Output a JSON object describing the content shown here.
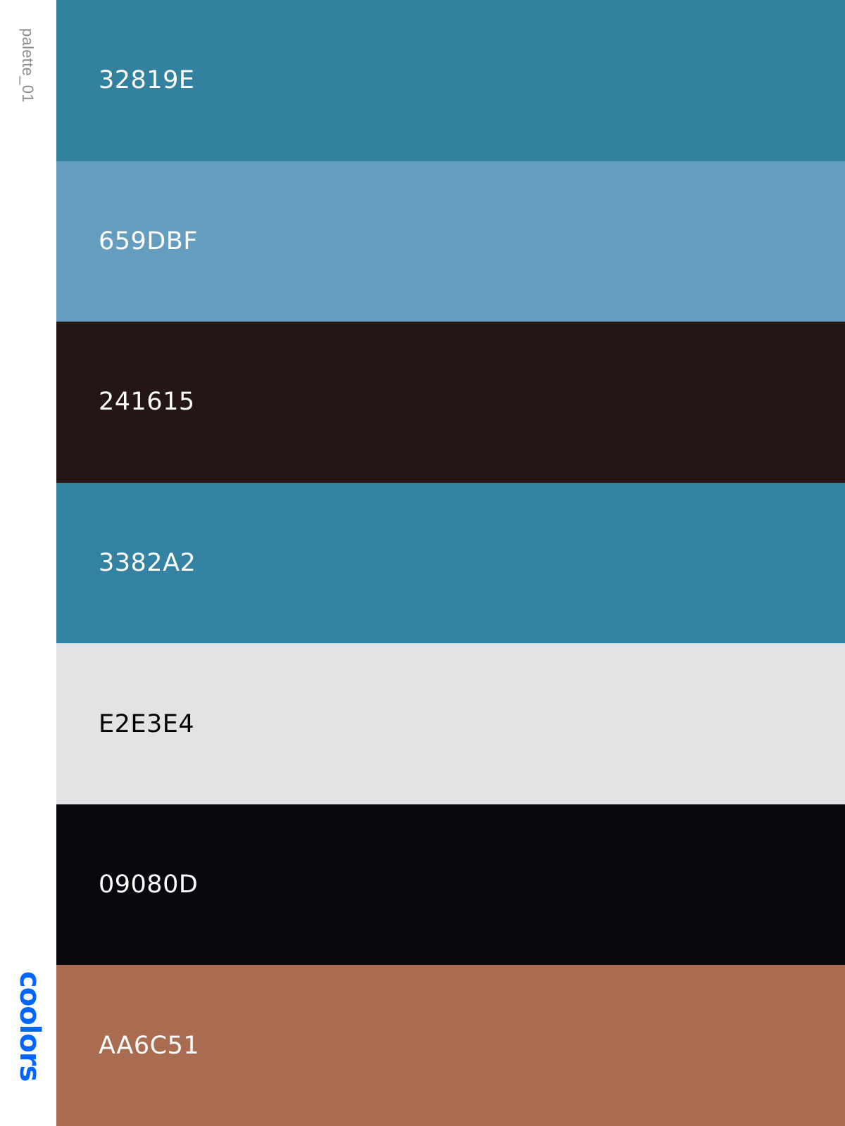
{
  "sidebar": {
    "palette_name": "palette_01",
    "brand": "coolors",
    "brand_color": "#0066FF"
  },
  "swatches": [
    {
      "label": "32819E",
      "color": "#32819E",
      "text_color": "#FFFFFF"
    },
    {
      "label": "659DBF",
      "color": "#659DBF",
      "text_color": "#FFFFFF"
    },
    {
      "label": "241615",
      "color": "#241615",
      "text_color": "#FFFFFF"
    },
    {
      "label": "3382A2",
      "color": "#3382A2",
      "text_color": "#FFFFFF"
    },
    {
      "label": "E2E3E4",
      "color": "#E2E3E4",
      "text_color": "#000000"
    },
    {
      "label": "09080D",
      "color": "#09080D",
      "text_color": "#FFFFFF"
    },
    {
      "label": "AA6C51",
      "color": "#AA6C51",
      "text_color": "#FFFFFF"
    }
  ]
}
